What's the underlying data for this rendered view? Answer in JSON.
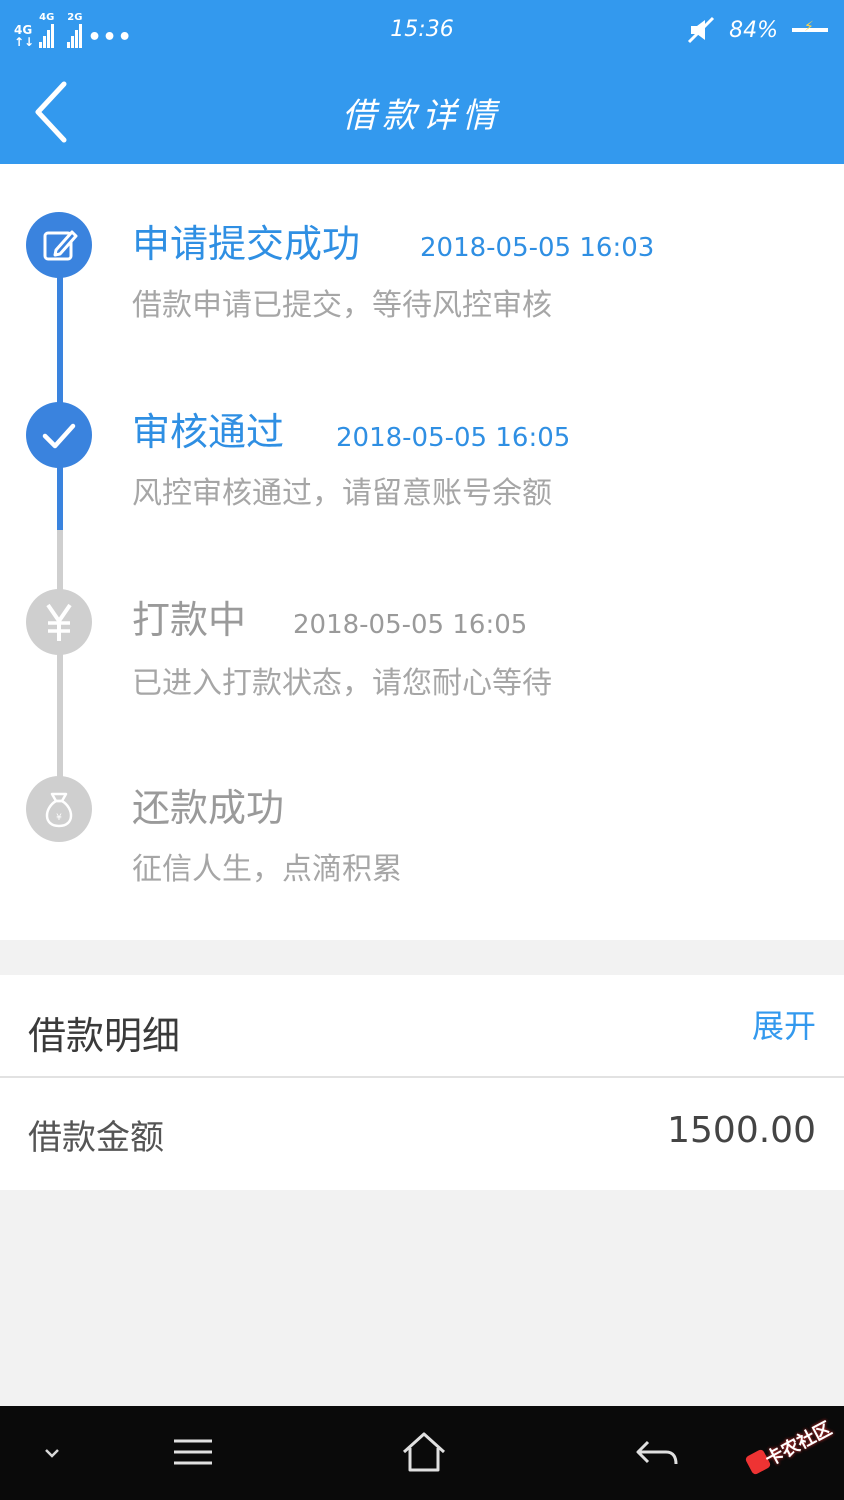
{
  "status_bar": {
    "network_1": "4G",
    "network_2": "4G",
    "network_3": "2G",
    "more": "•••",
    "time": "15:36",
    "battery_percent": "84%",
    "colors": {
      "background": "#3399ee"
    }
  },
  "nav": {
    "back_icon": "chevron-left-icon",
    "title": "借款详情"
  },
  "timeline": [
    {
      "title": "申请提交成功",
      "time": "2018-05-05 16:03",
      "desc": "借款申请已提交，等待风控审核",
      "icon": "edit-icon",
      "state": "done"
    },
    {
      "title": "审核通过",
      "time": "2018-05-05 16:05",
      "desc": "风控审核通过，请留意账号余额",
      "icon": "check-icon",
      "state": "done"
    },
    {
      "title": "打款中",
      "time": "2018-05-05 16:05",
      "desc": "已进入打款状态，请您耐心等待",
      "icon": "yen-icon",
      "state": "pending"
    },
    {
      "title": "还款成功",
      "time": "",
      "desc": "征信人生，点滴积累",
      "icon": "money-bag-icon",
      "state": "pending"
    }
  ],
  "timeline_colors": {
    "active": "#3a83de",
    "active_text": "#2f8fe3",
    "inactive": "#cfcfcf",
    "inactive_text": "#9a9a9a"
  },
  "loan_detail": {
    "title": "借款明细",
    "toggle": "展开",
    "amount_label": "借款金额",
    "amount_value": "1500.00"
  },
  "system_nav": {
    "buttons": [
      "chevron-down-icon",
      "menu-icon",
      "home-icon",
      "back-arrow-icon"
    ]
  },
  "watermark": {
    "text": "卡农社区"
  }
}
